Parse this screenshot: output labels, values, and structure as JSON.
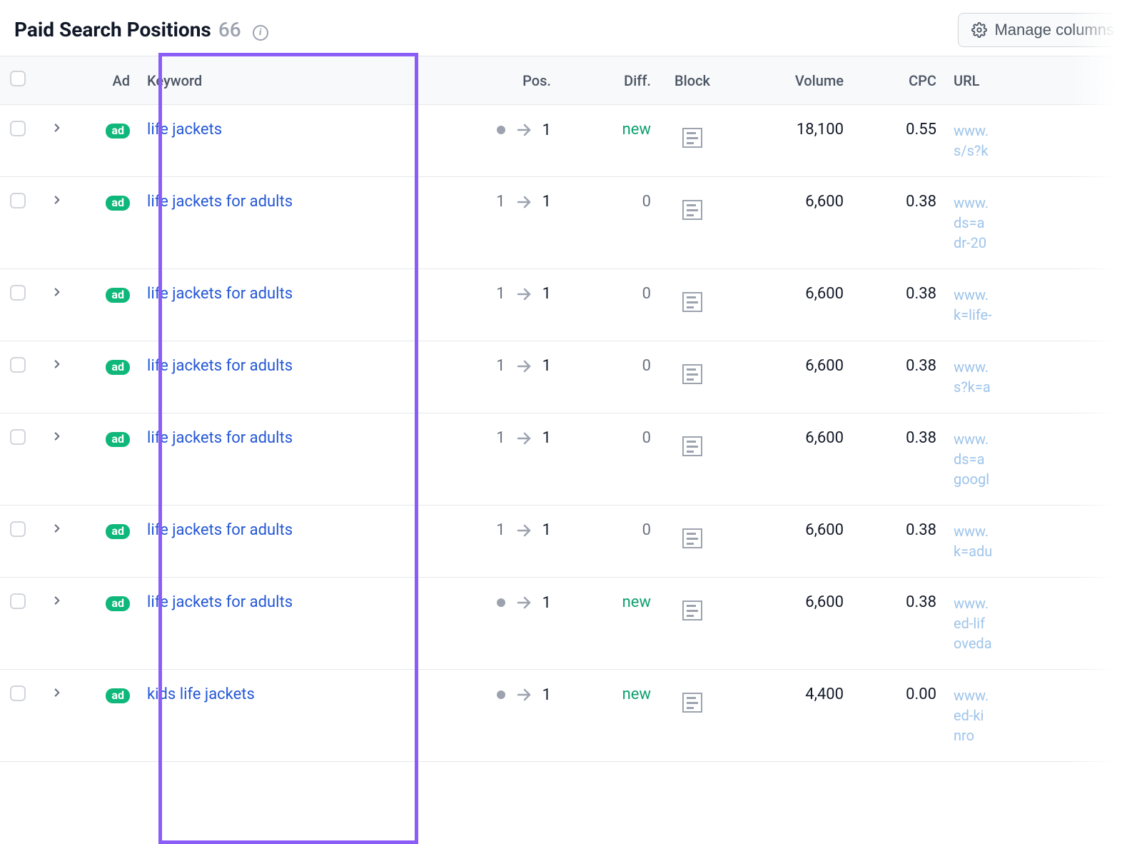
{
  "header": {
    "title": "Paid Search Positions",
    "count": "66",
    "manage_label": "Manage columns"
  },
  "columns": {
    "ad": "Ad",
    "keyword": "Keyword",
    "pos": "Pos.",
    "diff": "Diff.",
    "block": "Block",
    "volume": "Volume",
    "cpc": "CPC",
    "url": "URL"
  },
  "ad_badge": "ad",
  "rows": [
    {
      "keyword": "life jackets",
      "pos_prev": null,
      "pos_now": "1",
      "diff": "new",
      "diff_type": "new",
      "volume": "18,100",
      "cpc": "0.55",
      "url_lines": [
        "www.",
        "s/s?k"
      ]
    },
    {
      "keyword": "life jackets for adults",
      "pos_prev": "1",
      "pos_now": "1",
      "diff": "0",
      "diff_type": "zero",
      "volume": "6,600",
      "cpc": "0.38",
      "url_lines": [
        "www.",
        "ds=a",
        "dr-20"
      ]
    },
    {
      "keyword": "life jackets for adults",
      "pos_prev": "1",
      "pos_now": "1",
      "diff": "0",
      "diff_type": "zero",
      "volume": "6,600",
      "cpc": "0.38",
      "url_lines": [
        "www.",
        "k=life-"
      ]
    },
    {
      "keyword": "life jackets for adults",
      "pos_prev": "1",
      "pos_now": "1",
      "diff": "0",
      "diff_type": "zero",
      "volume": "6,600",
      "cpc": "0.38",
      "url_lines": [
        "www.",
        "s?k=a"
      ]
    },
    {
      "keyword": "life jackets for adults",
      "pos_prev": "1",
      "pos_now": "1",
      "diff": "0",
      "diff_type": "zero",
      "volume": "6,600",
      "cpc": "0.38",
      "url_lines": [
        "www.",
        "ds=a",
        "googl"
      ]
    },
    {
      "keyword": "life jackets for adults",
      "pos_prev": "1",
      "pos_now": "1",
      "diff": "0",
      "diff_type": "zero",
      "volume": "6,600",
      "cpc": "0.38",
      "url_lines": [
        "www.",
        "k=adu"
      ]
    },
    {
      "keyword": "life jackets for adults",
      "pos_prev": null,
      "pos_now": "1",
      "diff": "new",
      "diff_type": "new",
      "volume": "6,600",
      "cpc": "0.38",
      "url_lines": [
        "www.",
        "ed-lif",
        "oveda"
      ]
    },
    {
      "keyword": "kids life jackets",
      "pos_prev": null,
      "pos_now": "1",
      "diff": "new",
      "diff_type": "new",
      "volume": "4,400",
      "cpc": "0.00",
      "url_lines": [
        "www.",
        "ed-ki",
        "nro"
      ]
    }
  ]
}
